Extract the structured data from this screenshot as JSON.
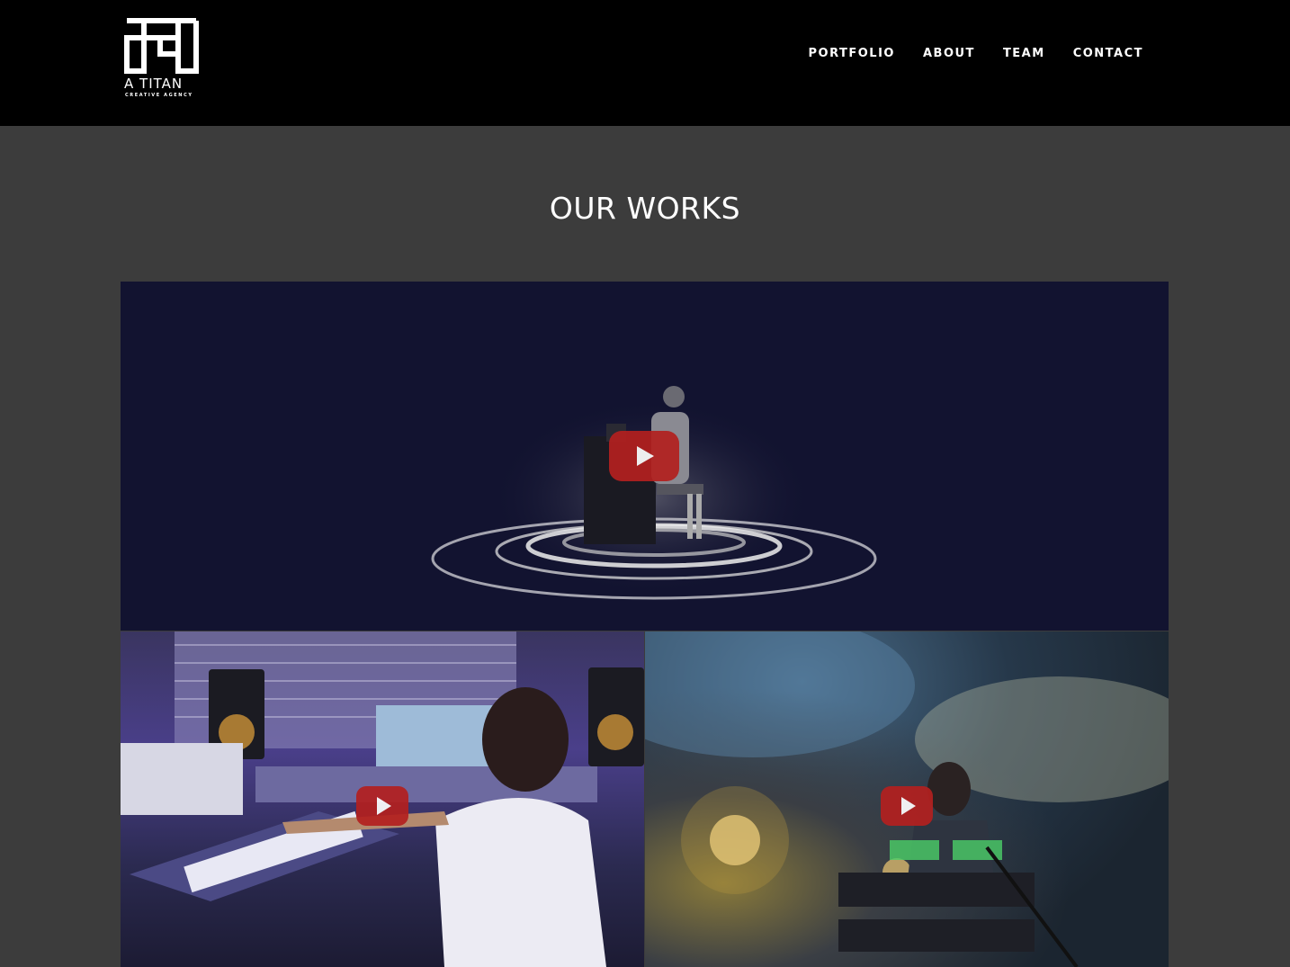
{
  "brand": {
    "name": "A TITAN",
    "tagline": "CREATIVE AGENCY"
  },
  "nav": {
    "items": [
      {
        "label": "PORTFOLIO"
      },
      {
        "label": "ABOUT"
      },
      {
        "label": "TEAM"
      },
      {
        "label": "CONTACT"
      }
    ]
  },
  "works": {
    "title": "OUR WORKS",
    "videos": [
      {
        "icon": "play-icon"
      },
      {
        "icon": "play-icon"
      },
      {
        "icon": "play-icon"
      }
    ]
  },
  "colors": {
    "header_bg": "#000000",
    "page_bg": "#3c3c3c",
    "play_button": "#b3201f",
    "text": "#ffffff"
  }
}
